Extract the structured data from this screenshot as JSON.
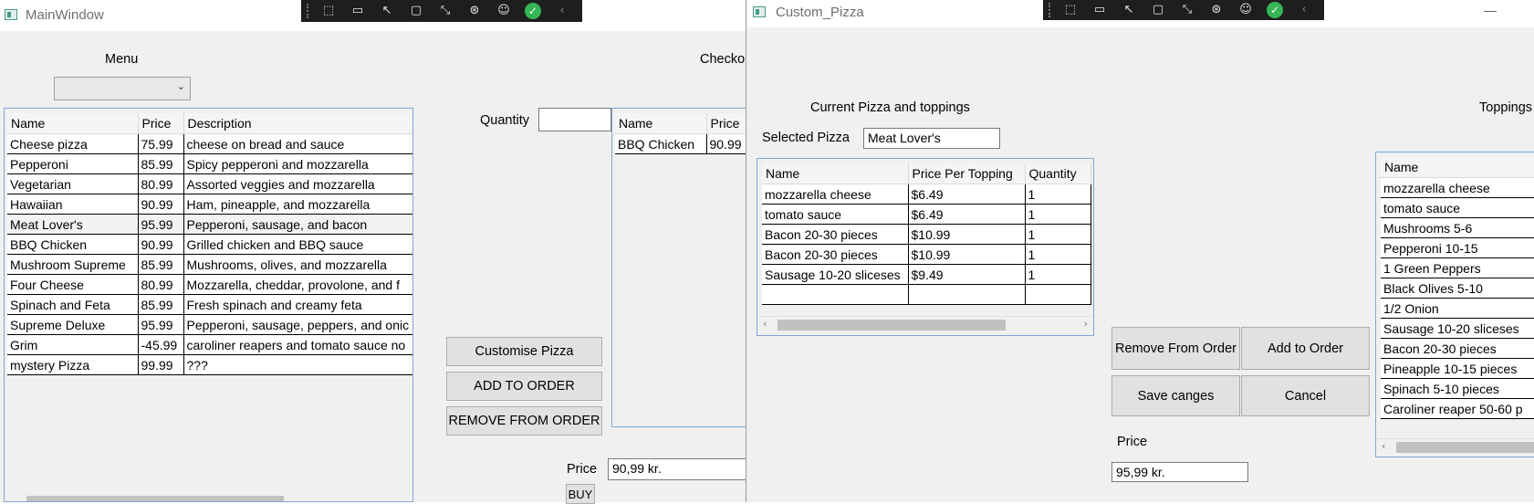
{
  "toolbar_icons": [
    "select-element-icon",
    "video-icon",
    "pointer-icon",
    "square-icon",
    "transform-icon",
    "track-icon",
    "accessibility-icon",
    "check-icon",
    "collapse-icon"
  ],
  "main": {
    "title": "MainWindow",
    "menu_label": "Menu",
    "checkout_label": "Checko",
    "quantity_label": "Quantity",
    "quantity_value": "",
    "menu_grid": {
      "headers": [
        "Name",
        "Price",
        "Description"
      ],
      "rows": [
        [
          "Cheese pizza",
          "75.99",
          "cheese on bread and sauce"
        ],
        [
          "Pepperoni",
          "85.99",
          "Spicy pepperoni and mozzarella"
        ],
        [
          "Vegetarian",
          "80.99",
          "Assorted veggies and mozzarella"
        ],
        [
          "Hawaiian",
          "90.99",
          "Ham, pineapple, and mozzarella"
        ],
        [
          "Meat Lover's",
          "95.99",
          "Pepperoni, sausage, and bacon"
        ],
        [
          "BBQ Chicken",
          "90.99",
          "Grilled chicken and BBQ sauce"
        ],
        [
          "Mushroom Supreme",
          "85.99",
          "Mushrooms, olives, and mozzarella"
        ],
        [
          "Four Cheese",
          "80.99",
          "Mozzarella, cheddar, provolone, and f"
        ],
        [
          "Spinach and Feta",
          "85.99",
          "Fresh spinach and creamy feta"
        ],
        [
          "Supreme Deluxe",
          "95.99",
          "Pepperoni, sausage, peppers, and onic"
        ],
        [
          "Grim",
          "-45.99",
          "caroliner reapers and tomato sauce no"
        ],
        [
          "mystery Pizza",
          "99.99",
          "???"
        ]
      ],
      "selected_row": 4
    },
    "order_grid": {
      "headers": [
        "Name",
        "Price"
      ],
      "rows": [
        [
          "BBQ Chicken",
          "90.99"
        ]
      ]
    },
    "buttons": {
      "customise": "Customise Pizza",
      "add": "ADD TO ORDER",
      "remove": "REMOVE FROM ORDER",
      "buy": "BUY"
    },
    "price_label": "Price",
    "price_value": "90,99 kr."
  },
  "custom": {
    "title": "Custom_Pizza",
    "current_label": "Current Pizza and toppings",
    "selected_label": "Selected Pizza",
    "selected_value": "Meat Lover's",
    "toppings_label": "Toppings",
    "current_grid": {
      "headers": [
        "Name",
        "Price Per Topping",
        "Quantity"
      ],
      "rows": [
        [
          "mozzarella cheese",
          "$6.49",
          "1"
        ],
        [
          "tomato sauce",
          "$6.49",
          "1"
        ],
        [
          "Bacon 20-30 pieces",
          "$10.99",
          "1"
        ],
        [
          "Bacon 20-30 pieces",
          "$10.99",
          "1"
        ],
        [
          "Sausage 10-20 sliceses",
          "$9.49",
          "1"
        ],
        [
          "",
          "",
          ""
        ]
      ]
    },
    "toppings_grid": {
      "headers": [
        "Name"
      ],
      "rows": [
        [
          "mozzarella cheese"
        ],
        [
          "tomato sauce"
        ],
        [
          "Mushrooms 5-6"
        ],
        [
          "Pepperoni 10-15"
        ],
        [
          "1 Green Peppers"
        ],
        [
          "Black Olives 5-10"
        ],
        [
          "1/2 Onion"
        ],
        [
          "Sausage 10-20 sliceses"
        ],
        [
          "Bacon 20-30 pieces"
        ],
        [
          "Pineapple 10-15 pieces"
        ],
        [
          "Spinach 5-10 pieces"
        ],
        [
          "Caroliner reaper 50-60 p"
        ]
      ]
    },
    "buttons": {
      "remove": "Remove From Order",
      "add": "Add to Order",
      "save": "Save canges",
      "cancel": "Cancel"
    },
    "price_label": "Price",
    "price_value": "95,99 kr.",
    "minimize_glyph": "—"
  }
}
